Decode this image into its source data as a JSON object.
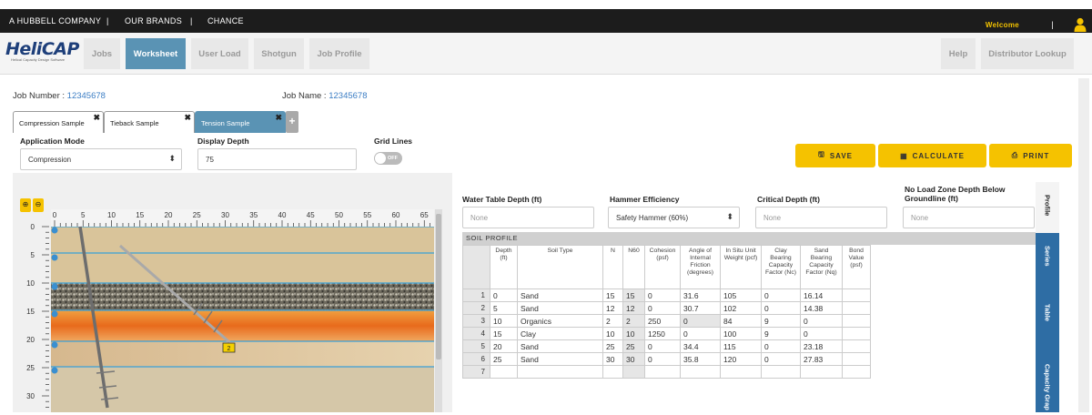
{
  "topbar": {
    "company": "A HUBBELL COMPANY",
    "sep1": "|",
    "brands": "OUR BRANDS",
    "sep2": "|",
    "chance": "CHANCE",
    "welcome": "Welcome",
    "sep3": "|"
  },
  "logo": {
    "name": "HeliCAP",
    "tagline": "Helical Capacity Design Software"
  },
  "nav": {
    "items": [
      "Jobs",
      "Worksheet",
      "User Load",
      "Shotgun",
      "Job Profile"
    ],
    "active": "Worksheet",
    "right": [
      "Help",
      "Distributor Lookup"
    ]
  },
  "job": {
    "number_label": "Job Number :",
    "number": "12345678",
    "name_label": "Job Name :",
    "name": "12345678"
  },
  "tabs": [
    "Compression Sample",
    "Tieback Sample",
    "Tension Sample"
  ],
  "tab_add": "+",
  "tab_close": "✖",
  "form": {
    "application_mode_label": "Application Mode",
    "application_mode": "Compression",
    "display_depth_label": "Display Depth",
    "display_depth": "75",
    "grid_lines_label": "Grid Lines",
    "grid_lines_state": "OFF"
  },
  "actions": {
    "save": "SAVE",
    "calculate": "CALCULATE",
    "print": "PRINT"
  },
  "profile": {
    "ruler_ticks": [
      "0",
      "5",
      "10",
      "15",
      "20",
      "25",
      "30",
      "35",
      "40",
      "45",
      "50",
      "55",
      "60",
      "65"
    ],
    "depth_ticks": [
      "0",
      "5",
      "10",
      "15",
      "20",
      "25",
      "30"
    ],
    "marker": "2"
  },
  "params": {
    "water_table_label": "Water Table Depth (ft)",
    "water_table_placeholder": "None",
    "hammer_label": "Hammer Efficiency",
    "hammer_value": "Safety Hammer (60%)",
    "critical_label": "Critical Depth (ft)",
    "critical_placeholder": "None",
    "noload_label": "No Load Zone Depth Below Groundline (ft)",
    "noload_placeholder": "None"
  },
  "soil_profile": {
    "title": "SOIL PROFILE",
    "columns": [
      "Depth (ft)",
      "Soil Type",
      "N",
      "N60",
      "Cohesion (psf)",
      "Angle of Internal Friction (degrees)",
      "In Situ Unit Weight (pcf)",
      "Clay Bearing Capacity Factor (Nc)",
      "Sand Bearing Capacity Factor (Nq)",
      "Bond Value (psf)"
    ],
    "rows": [
      {
        "num": "1",
        "depth": "0",
        "type": "Sand",
        "n": "15",
        "n60": "15",
        "cohesion": "0",
        "angle": "31.6",
        "weight": "105",
        "nc": "0",
        "nq": "16.14",
        "bond": ""
      },
      {
        "num": "2",
        "depth": "5",
        "type": "Sand",
        "n": "12",
        "n60": "12",
        "cohesion": "0",
        "angle": "30.7",
        "weight": "102",
        "nc": "0",
        "nq": "14.38",
        "bond": ""
      },
      {
        "num": "3",
        "depth": "10",
        "type": "Organics",
        "n": "2",
        "n60": "2",
        "cohesion": "250",
        "angle": "0",
        "weight": "84",
        "nc": "9",
        "nq": "0",
        "bond": ""
      },
      {
        "num": "4",
        "depth": "15",
        "type": "Clay",
        "n": "10",
        "n60": "10",
        "cohesion": "1250",
        "angle": "0",
        "weight": "100",
        "nc": "9",
        "nq": "0",
        "bond": ""
      },
      {
        "num": "5",
        "depth": "20",
        "type": "Sand",
        "n": "25",
        "n60": "25",
        "cohesion": "0",
        "angle": "34.4",
        "weight": "115",
        "nc": "0",
        "nq": "23.18",
        "bond": ""
      },
      {
        "num": "6",
        "depth": "25",
        "type": "Sand",
        "n": "30",
        "n60": "30",
        "cohesion": "0",
        "angle": "35.8",
        "weight": "120",
        "nc": "0",
        "nq": "27.83",
        "bond": ""
      },
      {
        "num": "7",
        "depth": "",
        "type": "",
        "n": "",
        "n60": "",
        "cohesion": "",
        "angle": "",
        "weight": "",
        "nc": "",
        "nq": "",
        "bond": ""
      }
    ]
  },
  "side_tabs": [
    "Profile",
    "Series",
    "Table",
    "Capacity Grap"
  ]
}
